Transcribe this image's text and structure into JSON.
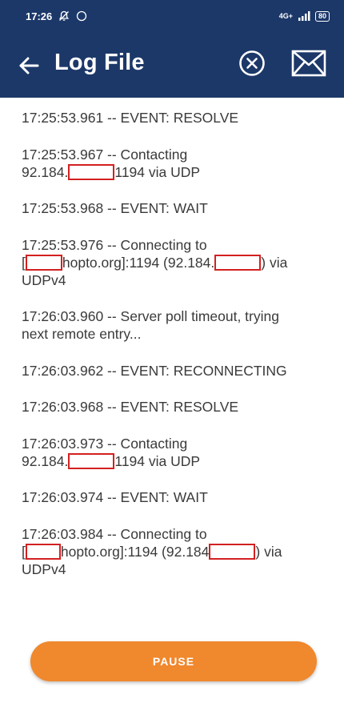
{
  "status_bar": {
    "time": "17:26",
    "network": "4G+",
    "battery": "80"
  },
  "app_bar": {
    "title": "Log File"
  },
  "log": {
    "entries": [
      [
        "17:25:53.961 -- EVENT: RESOLVE"
      ],
      [
        "17:25:53.967 -- Contacting",
        "92.184.",
        "1194 via UDP"
      ],
      [
        "17:25:53.968 -- EVENT: WAIT"
      ],
      [
        "17:25:53.976 -- Connecting to",
        "[",
        "hopto.org]:1194 (92.184.",
        ") via",
        "UDPv4"
      ],
      [
        "17:26:03.960 -- Server poll timeout, trying",
        "next remote entry..."
      ],
      [
        "17:26:03.962 -- EVENT: RECONNECTING"
      ],
      [
        "17:26:03.968 -- EVENT: RESOLVE"
      ],
      [
        "17:26:03.973 -- Contacting",
        "92.184.",
        "1194 via UDP"
      ],
      [
        "17:26:03.974 -- EVENT: WAIT"
      ],
      [
        "17:26:03.984 -- Connecting to",
        "[",
        "hopto.org]:1194 (92.184",
        ") via",
        "UDPv4"
      ]
    ]
  },
  "footer": {
    "pause_label": "PAUSE"
  }
}
